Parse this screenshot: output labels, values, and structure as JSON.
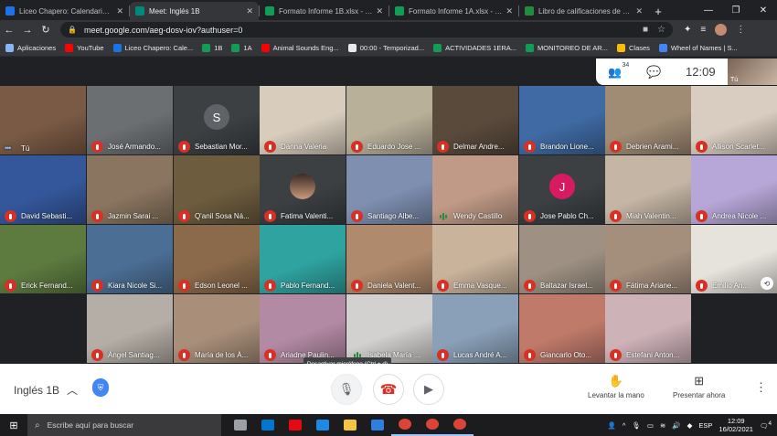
{
  "browser": {
    "tabs": [
      {
        "title": "Liceo Chapero: Calendario - m",
        "color": "#1a73e8",
        "active": false
      },
      {
        "title": "Meet: Inglés 1B",
        "color": "#00897b",
        "active": true
      },
      {
        "title": "Formato Informe 1B.xlsx - Hoj",
        "color": "#0f9d58",
        "active": false
      },
      {
        "title": "Formato Informe 1A.xlsx - Hoj",
        "color": "#0f9d58",
        "active": false
      },
      {
        "title": "Libro de calificaciones de Soc",
        "color": "#1e8e3e",
        "active": false
      }
    ],
    "url": "meet.google.com/aeg-dosv-iov?authuser=0",
    "bookmarks": [
      {
        "label": "Aplicaciones",
        "color": "#8ab4f8"
      },
      {
        "label": "YouTube",
        "color": "#ff0000"
      },
      {
        "label": "Liceo Chapero: Cale...",
        "color": "#1a73e8"
      },
      {
        "label": "1B",
        "color": "#0f9d58"
      },
      {
        "label": "1A",
        "color": "#0f9d58"
      },
      {
        "label": "Animal Sounds Eng...",
        "color": "#ff0000"
      },
      {
        "label": "00:00 - Temporizad...",
        "color": "#e8eaed"
      },
      {
        "label": "ACTIVIDADES 1ERA...",
        "color": "#0f9d58"
      },
      {
        "label": "MONITOREO DE AR...",
        "color": "#0f9d58"
      },
      {
        "label": "Clases",
        "color": "#fbbc04"
      },
      {
        "label": "Wheel of Names | S...",
        "color": "#4285f4"
      }
    ]
  },
  "meet": {
    "participant_count": "34",
    "time": "12:09",
    "self_label": "Tú",
    "meeting_name": "Inglés 1B",
    "mic_tooltip": "Desactivar micrófono (Ctrl + d)",
    "raise_hand": "Levantar la mano",
    "present_now": "Presentar ahora",
    "tiles": [
      {
        "name": "Tú",
        "status": "self",
        "bg": "#7a5a44"
      },
      {
        "name": "José Armando...",
        "status": "muted",
        "bg": "#6b6f72"
      },
      {
        "name": "Sebastian Mor...",
        "status": "muted",
        "bg": "#3c4043",
        "initial": "S",
        "avatar": "#5f6368"
      },
      {
        "name": "Danna Valeria",
        "status": "muted",
        "bg": "#d8cdbd"
      },
      {
        "name": "Eduardo Jose ...",
        "status": "muted",
        "bg": "#b9b09a"
      },
      {
        "name": "Delmar Andre...",
        "status": "muted",
        "bg": "#5a4a3c"
      },
      {
        "name": "Brandon Lione...",
        "status": "muted",
        "bg": "#3f6aa3"
      },
      {
        "name": "Debrien Arami...",
        "status": "muted",
        "bg": "#a08c74"
      },
      {
        "name": "Allison Scarlet...",
        "status": "muted",
        "bg": "#d9ccc0"
      },
      {
        "name": "David Sebasti...",
        "status": "muted",
        "bg": "#34569a"
      },
      {
        "name": "Jazmin Sarai ...",
        "status": "muted",
        "bg": "#8a7560"
      },
      {
        "name": "Q'anil Sosa Ná...",
        "status": "muted",
        "bg": "#6d5c3e"
      },
      {
        "name": "Fatima Valenti...",
        "status": "muted",
        "bg": "#3c4043",
        "photo": true
      },
      {
        "name": "Santiago Albe...",
        "status": "muted",
        "bg": "#7e8fb0"
      },
      {
        "name": "Wendy Castillo",
        "status": "speaking",
        "bg": "#c09a86"
      },
      {
        "name": "Jose Pablo Ch...",
        "status": "muted",
        "bg": "#3c4043",
        "initial": "J",
        "avatar": "#d81b60"
      },
      {
        "name": "Miah Valentin...",
        "status": "muted",
        "bg": "#c4b5a4"
      },
      {
        "name": "Andrea Nicole ...",
        "status": "muted",
        "bg": "#b7a7d8"
      },
      {
        "name": "Erick Fernand...",
        "status": "muted",
        "bg": "#5d7a3f"
      },
      {
        "name": "Kiara Nicole Si...",
        "status": "muted",
        "bg": "#4b6e94"
      },
      {
        "name": "Edson Leonel ...",
        "status": "muted",
        "bg": "#8a6a4b"
      },
      {
        "name": "Pablo Fernand...",
        "status": "muted",
        "bg": "#2fa3a0"
      },
      {
        "name": "Daniela Valent...",
        "status": "muted",
        "bg": "#b08a6c"
      },
      {
        "name": "Emma Vasque...",
        "status": "muted",
        "bg": "#c9b39b"
      },
      {
        "name": "Baltazar Israel...",
        "status": "muted",
        "bg": "#9e9183"
      },
      {
        "name": "Fátima Ariane...",
        "status": "muted",
        "bg": "#a48e7c"
      },
      {
        "name": "Emilio An...",
        "status": "muted",
        "bg": "#e6e2dc",
        "pin": true
      },
      {
        "name": "",
        "status": "empty",
        "bg": "#202124"
      },
      {
        "name": "Ángel Santiag...",
        "status": "muted",
        "bg": "#b5aea6"
      },
      {
        "name": "María de los Á...",
        "status": "muted",
        "bg": "#a98f7a"
      },
      {
        "name": "Ariadne Paulin...",
        "status": "muted",
        "bg": "#b38aa4"
      },
      {
        "name": "Isabela María ...",
        "status": "speaking",
        "bg": "#d3d1cf"
      },
      {
        "name": "Lucas André A...",
        "status": "muted",
        "bg": "#8aa0b8"
      },
      {
        "name": "Giancarlo Oto...",
        "status": "muted",
        "bg": "#c07a6a"
      },
      {
        "name": "Estefani Anton...",
        "status": "muted",
        "bg": "#cdb2b8"
      },
      {
        "name": "",
        "status": "empty",
        "bg": "#202124"
      }
    ]
  },
  "taskbar": {
    "search_placeholder": "Escribe aquí para buscar",
    "language": "ESP",
    "time": "12:09",
    "date": "16/02/2021",
    "notifications": "4",
    "apps": [
      {
        "name": "task-view",
        "color": "#9aa0a6",
        "running": false
      },
      {
        "name": "dell",
        "color": "#0076ce",
        "running": false
      },
      {
        "name": "netflix",
        "color": "#e50914",
        "running": false
      },
      {
        "name": "edge",
        "color": "#1e88e5",
        "running": false
      },
      {
        "name": "explorer",
        "color": "#f4c542",
        "running": false
      },
      {
        "name": "mail",
        "color": "#2f7de1",
        "running": false
      },
      {
        "name": "chrome",
        "color": "#db4437",
        "running": true
      },
      {
        "name": "chrome",
        "color": "#db4437",
        "running": true
      },
      {
        "name": "chrome",
        "color": "#db4437",
        "running": true
      }
    ]
  }
}
